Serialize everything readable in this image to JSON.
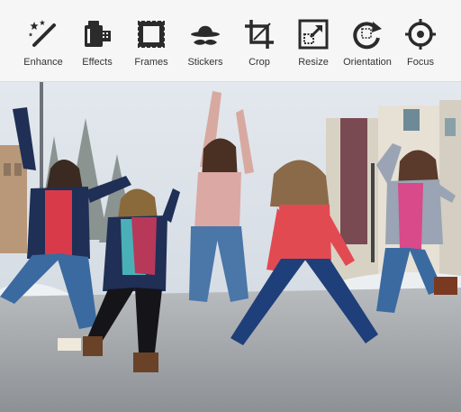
{
  "toolbar": {
    "tools": [
      {
        "label": "Enhance",
        "icon": "magic-wand-icon"
      },
      {
        "label": "Effects",
        "icon": "effects-icon"
      },
      {
        "label": "Frames",
        "icon": "frame-icon"
      },
      {
        "label": "Stickers",
        "icon": "hat-mustache-icon"
      },
      {
        "label": "Crop",
        "icon": "crop-icon"
      },
      {
        "label": "Resize",
        "icon": "resize-icon"
      },
      {
        "label": "Orientation",
        "icon": "rotate-icon"
      },
      {
        "label": "Focus",
        "icon": "focus-target-icon"
      }
    ]
  },
  "colors": {
    "toolbar_bg": "#f6f6f6",
    "icon": "#2b2b2b",
    "label": "#333333"
  }
}
